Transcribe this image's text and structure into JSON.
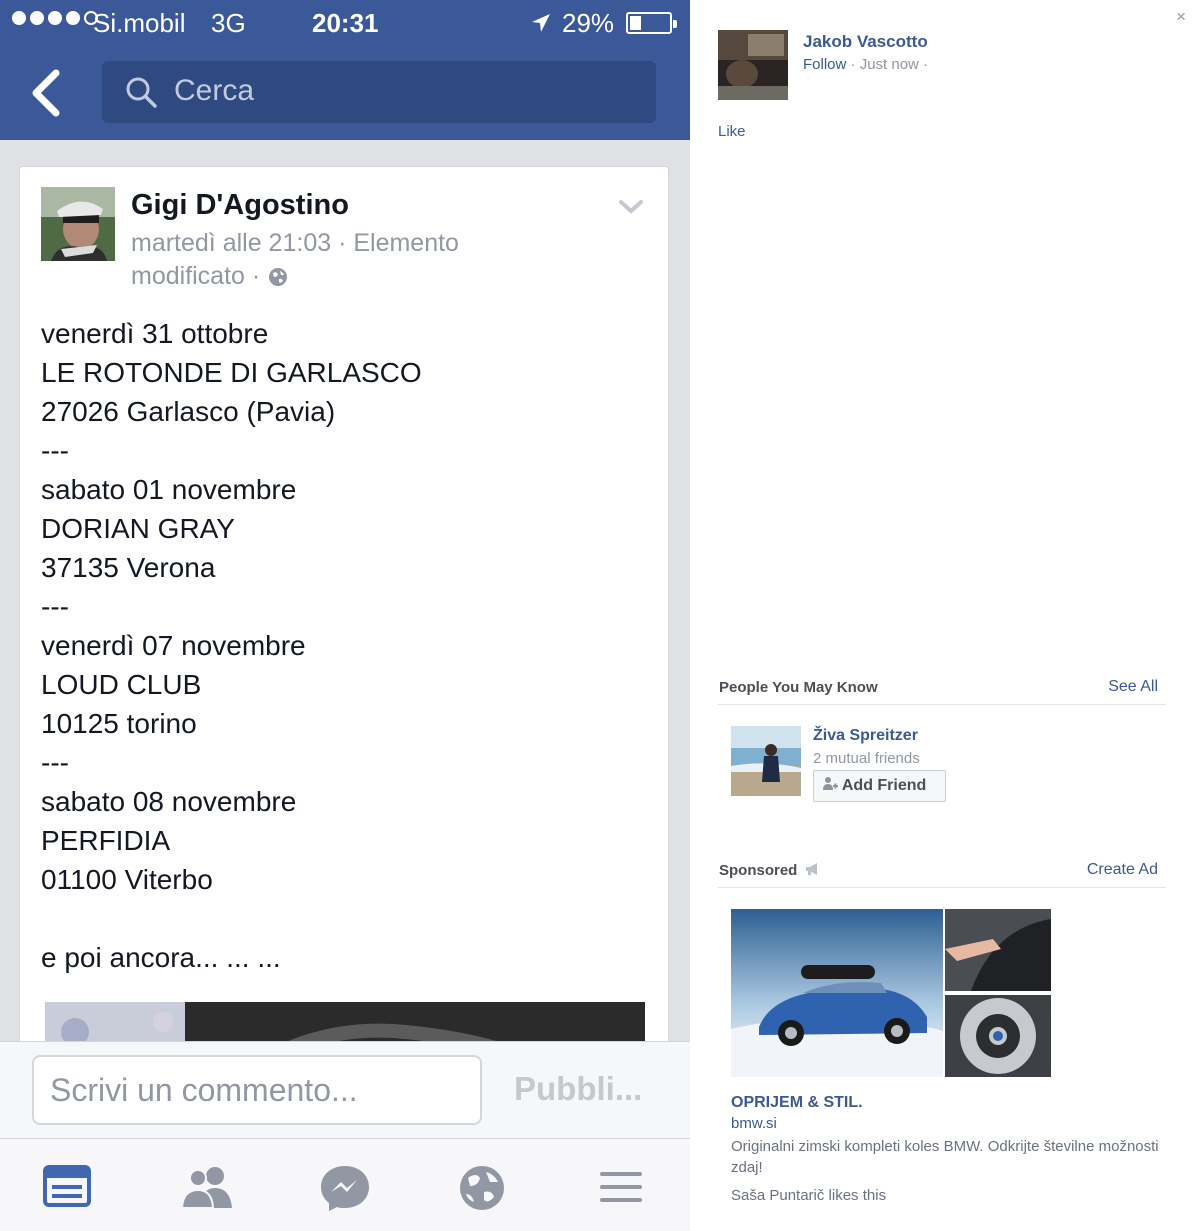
{
  "status_bar": {
    "carrier": "Si.mobil",
    "network": "3G",
    "time": "20:31",
    "battery_percent_label": "29%",
    "battery_level": 0.29,
    "signal_bars_filled": 4,
    "signal_bars_total": 5
  },
  "nav": {
    "search_placeholder": "Cerca"
  },
  "post": {
    "author": "Gigi D'Agostino",
    "meta_line1": "martedì alle 21:03 · Elemento",
    "meta_line2": "modificato ·",
    "body_lines": [
      "venerdì 31 ottobre",
      "LE ROTONDE DI GARLASCO",
      "27026 Garlasco (Pavia)",
      "---",
      "sabato 01 novembre",
      "DORIAN GRAY",
      "37135 Verona",
      "---",
      "venerdì 07 novembre",
      "LOUD CLUB",
      "10125 torino",
      "---",
      "sabato 08 novembre",
      "PERFIDIA",
      "01100 Viterbo",
      "",
      "e poi ancora... ... ..."
    ]
  },
  "comment": {
    "placeholder": "Scrivi un commento...",
    "publish_label": "Pubbli..."
  },
  "tabs": [
    "news-feed",
    "friends",
    "messenger",
    "notifications",
    "more"
  ],
  "sidebar": {
    "close_symbol": "×",
    "story": {
      "name": "Jakob Vascotto",
      "follow_label": "Follow",
      "meta": " · Just now ·",
      "like_label": "Like"
    },
    "pymk": {
      "title": "People You May Know",
      "see_all": "See All",
      "person_name": "Živa Spreitzer",
      "mutual": "2 mutual friends",
      "add_friend": "Add Friend"
    },
    "sponsored": {
      "title": "Sponsored",
      "create_ad": "Create Ad",
      "ad_title": "OPRIJEM & STIL.",
      "ad_domain": "bmw.si",
      "ad_text": "Originalni zimski kompleti koles BMW. Odkrijte številne možnosti zdaj!",
      "ad_social": "Saša Puntarič likes this"
    }
  },
  "colors": {
    "facebook_blue": "#3b5998",
    "active_tab": "#4267b2",
    "inactive_tab": "#9197a3"
  }
}
